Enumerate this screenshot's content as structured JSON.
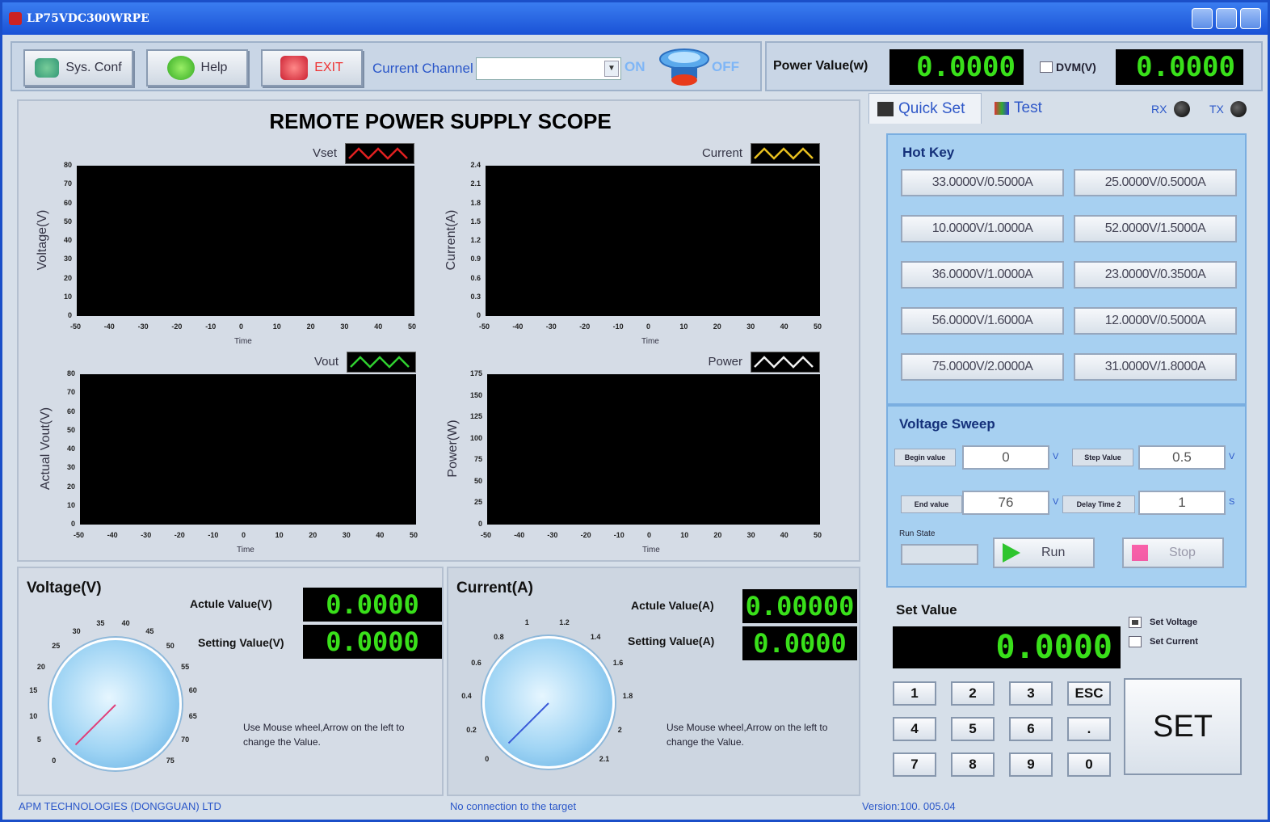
{
  "window": {
    "title": "LP75VDC300WRPE"
  },
  "toolbar": {
    "sys_conf_label": "Sys. Conf",
    "help_label": "Help",
    "exit_label": "EXIT",
    "channel_label": "Current Channel",
    "channel_value": "",
    "on_label": "ON",
    "off_label": "OFF"
  },
  "power": {
    "label": "Power Value(w)",
    "value": "0.0000",
    "dvm_label": "DVM(V)",
    "dvm_checked": false,
    "dvm_value": "0.0000"
  },
  "scope": {
    "title": "REMOTE POWER SUPPLY SCOPE",
    "x_ticks": [
      "-50",
      "-40",
      "-30",
      "-20",
      "-10",
      "0",
      "10",
      "20",
      "30",
      "40",
      "50"
    ],
    "x_label": "Time",
    "charts": [
      {
        "legend": "Vset",
        "legend_color": "#e02020",
        "ylabel": "Voltage(V)",
        "y_ticks": [
          "80",
          "70",
          "60",
          "50",
          "40",
          "30",
          "20",
          "10",
          "0"
        ]
      },
      {
        "legend": "Current",
        "legend_color": "#e8c020",
        "ylabel": "Current(A)",
        "y_ticks": [
          "2.4",
          "2.1",
          "1.8",
          "1.5",
          "1.2",
          "0.9",
          "0.6",
          "0.3",
          "0"
        ]
      },
      {
        "legend": "Vout",
        "legend_color": "#30d030",
        "ylabel": "Actual Vout(V)",
        "y_ticks": [
          "80",
          "70",
          "60",
          "50",
          "40",
          "30",
          "20",
          "10",
          "0"
        ]
      },
      {
        "legend": "Power",
        "legend_color": "#f0f0f0",
        "ylabel": "Power(W)",
        "y_ticks": [
          "175",
          "150",
          "125",
          "100",
          "75",
          "50",
          "25",
          "0"
        ]
      }
    ]
  },
  "voltage_gauge": {
    "title": "Voltage(V)",
    "actual_label": "Actule Value(V)",
    "actual_value": "0.0000",
    "setting_label": "Setting Value(V)",
    "setting_value": "0.0000",
    "dial_value": 0,
    "hint": "Use Mouse wheel,Arrow on the left to change the Value.",
    "ticks": [
      "0",
      "5",
      "10",
      "15",
      "20",
      "25",
      "30",
      "35",
      "40",
      "45",
      "50",
      "55",
      "60",
      "65",
      "70",
      "75"
    ]
  },
  "current_gauge": {
    "title": "Current(A)",
    "actual_label": "Actule Value(A)",
    "actual_value": "0.00000",
    "setting_label": "Setting Value(A)",
    "setting_value": "0.0000",
    "dial_value": 0,
    "hint": "Use Mouse wheel,Arrow on the left to change the Value.",
    "ticks": [
      "0",
      "0.2",
      "0.4",
      "0.6",
      "0.8",
      "1",
      "1.2",
      "1.4",
      "1.6",
      "1.8",
      "2",
      "2.1"
    ]
  },
  "side": {
    "tabs": [
      {
        "label": "Quick Set"
      },
      {
        "label": "Test"
      }
    ],
    "rx_label": "RX",
    "tx_label": "TX",
    "hotkey": {
      "title": "Hot Key",
      "buttons": [
        "33.0000V/0.5000A",
        "25.0000V/0.5000A",
        "10.0000V/1.0000A",
        "52.0000V/1.5000A",
        "36.0000V/1.0000A",
        "23.0000V/0.3500A",
        "56.0000V/1.6000A",
        "12.0000V/0.5000A",
        "75.0000V/2.0000A",
        "31.0000V/1.8000A"
      ]
    },
    "sweep": {
      "title": "Voltage Sweep",
      "begin_label": "Begin value",
      "begin_value": "0",
      "step_label": "Step Value",
      "step_value": "0.5",
      "end_label": "End value",
      "end_value": "76",
      "delay_label": "Delay Time 2",
      "delay_value": "1",
      "v_unit": "V",
      "s_unit": "S",
      "run_state_label": "Run State",
      "run_label": "Run",
      "stop_label": "Stop"
    },
    "set_value": {
      "title": "Set Value",
      "value": "0.0000",
      "radio_voltage": "Set Voltage",
      "radio_current": "Set Current",
      "keys": [
        "1",
        "2",
        "3",
        "ESC",
        "4",
        "5",
        "6",
        ".",
        "7",
        "8",
        "9",
        "0"
      ],
      "set_label": "SET"
    }
  },
  "status": {
    "company": "APM TECHNOLOGIES (DONGGUAN) LTD",
    "connection": "No connection to the target",
    "version": "Version:100. 005.04"
  }
}
